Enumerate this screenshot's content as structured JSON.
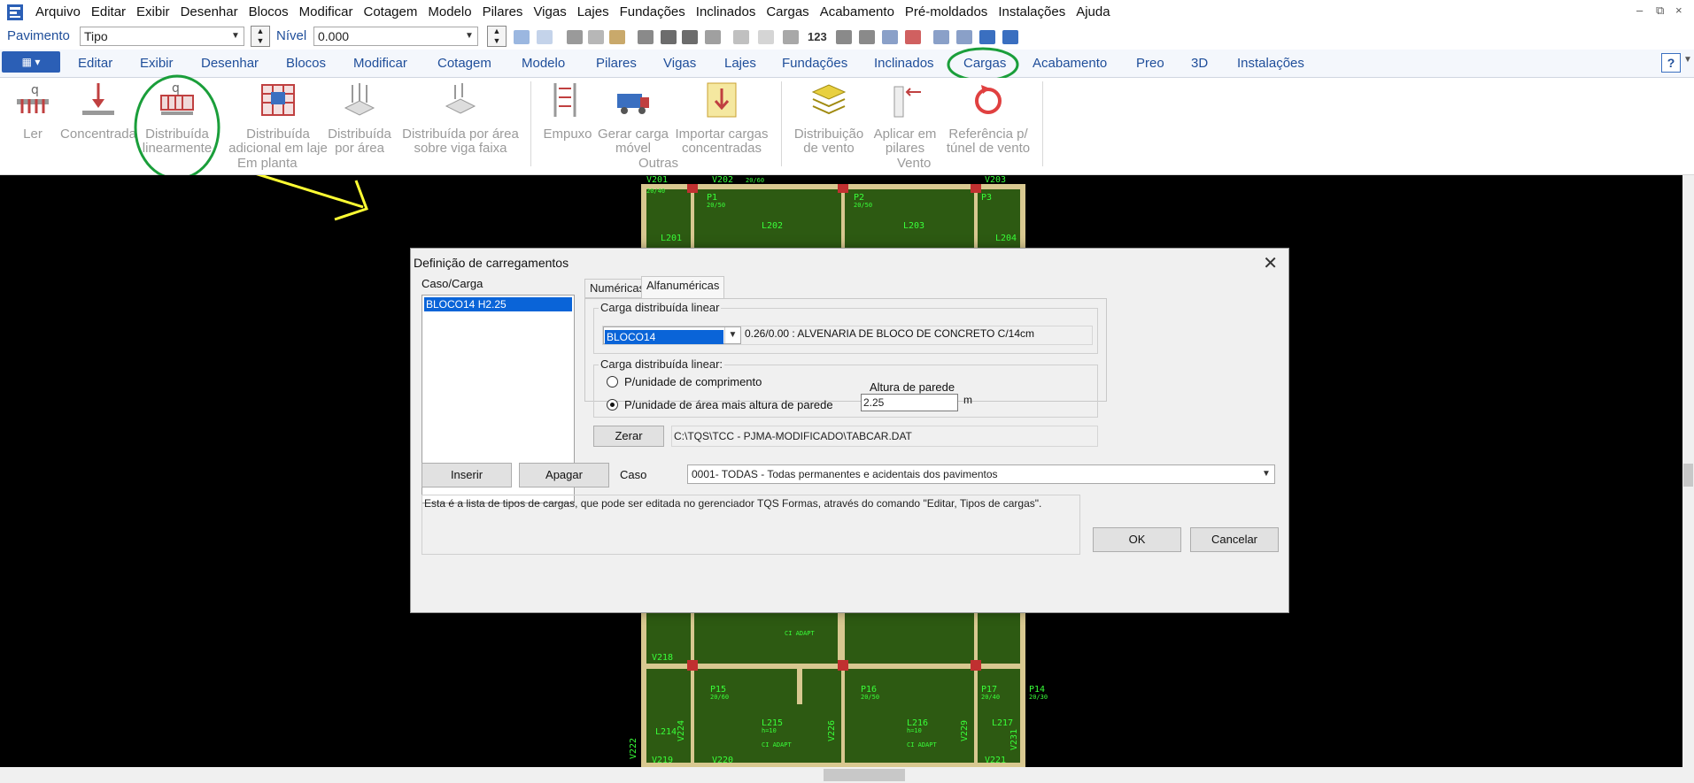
{
  "menubar": {
    "items": [
      "Arquivo",
      "Editar",
      "Exibir",
      "Desenhar",
      "Blocos",
      "Modificar",
      "Cotagem",
      "Modelo",
      "Pilares",
      "Vigas",
      "Lajes",
      "Fundações",
      "Inclinados",
      "Cargas",
      "Acabamento",
      "Pré-moldados",
      "Instalações",
      "Ajuda"
    ],
    "window_controls": [
      "–",
      "⧉",
      "×"
    ]
  },
  "toolbar2": {
    "pavimento_label": "Pavimento",
    "pavimento_value": "Tipo",
    "nivel_label": "Nível",
    "nivel_value": "0.000",
    "icon_text_123": "123"
  },
  "ribbon_tabs": {
    "items": [
      "Editar",
      "Exibir",
      "Desenhar",
      "Blocos",
      "Modificar",
      "Cotagem",
      "Modelo",
      "Pilares",
      "Vigas",
      "Lajes",
      "Fundações",
      "Inclinados",
      "Cargas",
      "Acabamento",
      "Preo",
      "3D",
      "Instalações"
    ],
    "active": "Cargas",
    "help": "?"
  },
  "ribbon": {
    "buttons": [
      {
        "l1": "Ler",
        "l2": ""
      },
      {
        "l1": "Concentrada",
        "l2": ""
      },
      {
        "l1": "Distribuída",
        "l2": "linearmente"
      },
      {
        "l1": "Distribuída",
        "l2": "adicional em laje"
      },
      {
        "l1": "Distribuída",
        "l2": "por área"
      },
      {
        "l1": "Distribuída por área",
        "l2": "sobre viga faixa"
      },
      {
        "l1": "Empuxo",
        "l2": ""
      },
      {
        "l1": "Gerar carga",
        "l2": "móvel"
      },
      {
        "l1": "Importar cargas",
        "l2": "concentradas"
      },
      {
        "l1": "Distribuição",
        "l2": "de vento"
      },
      {
        "l1": "Aplicar em",
        "l2": "pilares"
      },
      {
        "l1": "Referência p/",
        "l2": "túnel de vento"
      }
    ],
    "groups": [
      "Em planta",
      "Outras",
      "Vento"
    ]
  },
  "cad": {
    "labels_top": [
      "V201",
      "V202",
      "V203",
      "P1",
      "P2",
      "P3",
      "L201",
      "L202",
      "L203",
      "L204"
    ],
    "labels_bottom": [
      "P14",
      "V218",
      "P15",
      "P16",
      "P17",
      "L214",
      "L215",
      "L216",
      "L217",
      "V219",
      "V220",
      "V221",
      "V222",
      "V224",
      "V226",
      "V229",
      "V231"
    ],
    "dims": [
      "20/40",
      "20/50",
      "20/60",
      "20/30",
      "h=10",
      "h=8",
      "CI ADAPT"
    ]
  },
  "dialog": {
    "title": "Definição de carregamentos",
    "close": "✕",
    "caso_carga_label": "Caso/Carga",
    "list_items": [
      "BLOCO14 H2.25"
    ],
    "tabs": [
      "Numéricas",
      "Alfanuméricas"
    ],
    "active_tab": "Alfanuméricas",
    "group1_legend": "Carga distribuída linear",
    "carga_select": "BLOCO14",
    "carga_desc": "0.26/0.00 : ALVENARIA DE BLOCO DE CONCRETO C/14cm",
    "group2_legend": "Carga distribuída linear:",
    "radio1": "P/unidade de comprimento",
    "radio2": "P/unidade de área mais altura de parede",
    "radio_selected": 2,
    "altura_label": "Altura de parede",
    "altura_value": "2.25",
    "altura_unit": "m",
    "zerar": "Zerar",
    "path": "C:\\TQS\\TCC - PJMA-MODIFICADO\\TABCAR.DAT",
    "inserir": "Inserir",
    "apagar": "Apagar",
    "caso_label": "Caso",
    "caso_value": "0001- TODAS - Todas permanentes e acidentais dos pavimentos",
    "help_text": "Esta é a lista de tipos de cargas, que pode ser editada no gerenciador TQS Formas, através do comando \"Editar, Tipos de cargas\".",
    "ok": "OK",
    "cancel": "Cancelar"
  },
  "colors": {
    "accent": "#1f4e9a",
    "highlight_circle": "#1a9e3a",
    "arrow": "#ffff33",
    "cad_slab": "#2d5a12",
    "cad_beam": "#d8c890",
    "cad_text": "#39ff39",
    "selection": "#0a64d8"
  }
}
